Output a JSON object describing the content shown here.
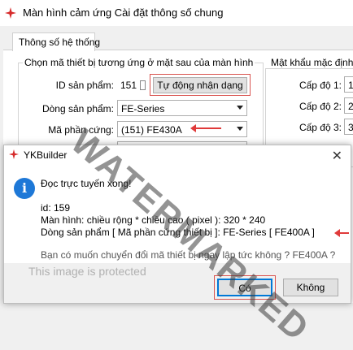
{
  "window": {
    "title": "Màn hình cảm ứng Cài đặt thông số chung",
    "brand_color": "#d62b2b"
  },
  "tabs": [
    {
      "label": "Thông số hệ thống"
    }
  ],
  "device_group": {
    "title": "Chọn mã thiết bị tương ứng ở mặt sau của màn hình",
    "product_id_label": "ID sản phẩm:",
    "product_id_value": "151",
    "auto_detect_button": "Tự động nhận dạng",
    "product_line_label": "Dòng sản phẩm:",
    "product_line_value": "FE-Series",
    "hardware_code_label": "Mã phần cứng:",
    "hardware_code_value": "(151) FE430A"
  },
  "password_group": {
    "title": "Mật khẩu mặc định c",
    "levels": [
      {
        "label": "Cấp độ 1:",
        "value": "1"
      },
      {
        "label": "Cấp độ 2:",
        "value": "2"
      },
      {
        "label": "Cấp độ 3:",
        "value": "3"
      }
    ]
  },
  "dialog": {
    "title": "YKBuilder",
    "icon": "info-icon",
    "line1": "Đọc trực tuyến xong!",
    "line2": "id: 159",
    "line3": "Màn hình: chiều rộng * chiều cao ( pixel ):  320 * 240",
    "line4": "Dòng sản phẩm  [ Mã phần cứng thiết bị ]:  FE-Series  [ FE400A ]",
    "line5": "Bạn có muốn chuyển đổi mã thiết bị ngay lập tức không ? FE400A ?",
    "yes_button": "Có",
    "no_button": "Không"
  },
  "overlay": {
    "watermark": "WATERMARKED",
    "protected_notice": "This image is protected"
  },
  "annotation_color": "#e03a3a"
}
